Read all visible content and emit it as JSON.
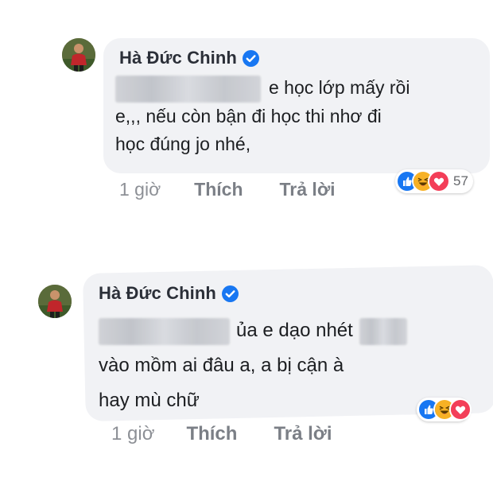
{
  "comments": [
    {
      "author": "Hà Đức Chinh",
      "verified": true,
      "text_lines": [
        "e học lớp mấy rồi",
        "e,,, nếu còn bận đi học thi nhơ đi",
        "học đúng jo nhé,"
      ],
      "reactions": [
        "like-icon",
        "haha-icon",
        "love-icon"
      ],
      "reaction_count": "57",
      "time": "1 giờ",
      "like_label": "Thích",
      "reply_label": "Trả lời"
    },
    {
      "author": "Hà Đức Chinh",
      "verified": true,
      "text_lines": [
        "ủa e dạo nhét",
        "vào mồm ai đâu a, a bị cận à",
        "hay mù chữ"
      ],
      "reactions": [
        "like-icon",
        "haha-icon",
        "love-icon"
      ],
      "time": "1 giờ",
      "like_label": "Thích",
      "reply_label": "Trả lời"
    }
  ],
  "colors": {
    "bubble": "#f1f2f5",
    "verified_badge": "#1877f2",
    "like": "#1877f2",
    "haha": "#f7b125",
    "love": "#f33e58"
  }
}
